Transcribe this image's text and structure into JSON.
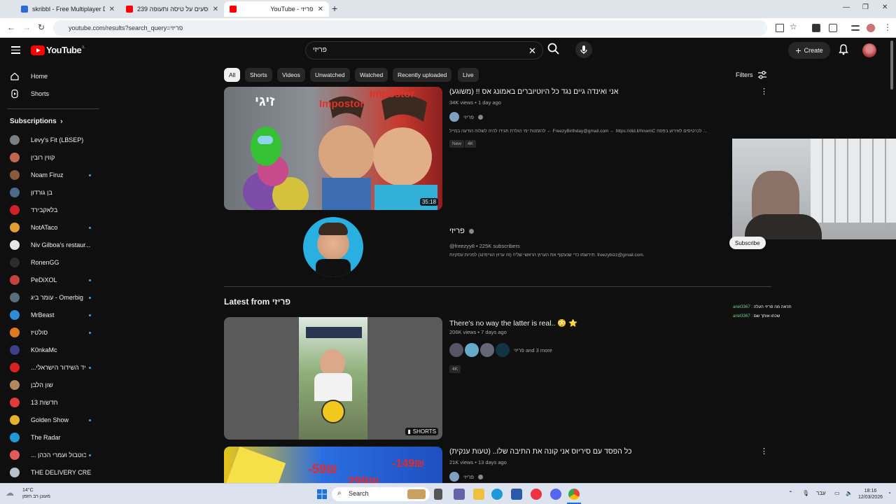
{
  "browser": {
    "tabs": [
      {
        "label": "skribbl - Free Multiplayer Draw",
        "color": "#2b6cd4"
      },
      {
        "label": "239 נוסעים על טיסה ותעופה | Tw",
        "color": "#ff0000"
      },
      {
        "label": "YouTube - פריזי",
        "color": "#ff0000"
      }
    ],
    "url": "youtube.com/results?search_query=פריזי"
  },
  "youtube": {
    "logo_text": "YouTube",
    "logo_country": "IL",
    "search_value": "פריזי",
    "create_label": "Create",
    "sidebar": {
      "home": "Home",
      "shorts": "Shorts",
      "subscriptions": "Subscriptions",
      "subs": [
        {
          "name": "Levy's Fit (LBSEP)",
          "color": "#7a7f86",
          "dot": false
        },
        {
          "name": "קווין רובין",
          "color": "#c0684f",
          "dot": false
        },
        {
          "name": "Noam Firuz",
          "color": "#8b5a3c",
          "dot": true
        },
        {
          "name": "בן גורדון",
          "color": "#4b6b8a",
          "dot": false
        },
        {
          "name": "בלאקבירד",
          "color": "#d0202a",
          "dot": false
        },
        {
          "name": "NotATaco",
          "color": "#e0a030",
          "dot": true
        },
        {
          "name": "Niv Gilboa's restaur...",
          "color": "#e6e6e6",
          "dot": false
        },
        {
          "name": "RonenGG",
          "color": "#2c2c2c",
          "dot": false
        },
        {
          "name": "PeDiXOL",
          "color": "#c6423c",
          "dot": true
        },
        {
          "name": "עומר ביג - Omerbig",
          "color": "#5a6e7a",
          "dot": true
        },
        {
          "name": "MrBeast",
          "color": "#2d8cd6",
          "dot": true
        },
        {
          "name": "סולטיז",
          "color": "#e07a1f",
          "dot": true
        },
        {
          "name": "K0nkaMc",
          "color": "#3d3f8a",
          "dot": false
        },
        {
          "name": "...יד השידור הישראלי",
          "color": "#d92121",
          "dot": true
        },
        {
          "name": "שון הלבן",
          "color": "#b08a5c",
          "dot": false
        },
        {
          "name": "חדשות 13",
          "color": "#e23b3b",
          "dot": false
        },
        {
          "name": "Golden Show",
          "color": "#e6b12c",
          "dot": true
        },
        {
          "name": "The Radar",
          "color": "#1f9ad6",
          "dot": false
        },
        {
          "name": "... בוטבול ועמרי הכהן",
          "color": "#e25b5b",
          "dot": true
        },
        {
          "name": "THE DELIVERY CRE...",
          "color": "#b9c2cc",
          "dot": false
        }
      ]
    },
    "chips": [
      "All",
      "Shorts",
      "Videos",
      "Unwatched",
      "Watched",
      "Recently uploaded",
      "Live"
    ],
    "filters_label": "Filters",
    "results": [
      {
        "title": "אני ואינדה גיים נגד כל היוטיוברים באמונג אס !! (משוגע)",
        "meta": "34K views • 1 day ago",
        "channel": "פריזי",
        "description": "להזמנות ימי הולדת תגידו להיה לשלוח הודעה במייל ← FreezyBirthday@gmail.com ← https://did.li/hnwmC לכרטיסים לאירוע בפסח ...",
        "badges": [
          "New",
          "4K"
        ],
        "duration": "35:18",
        "thumb_text_1": "זיגי",
        "thumb_text_2": "Impostor"
      }
    ],
    "channel": {
      "name": "פריזי",
      "handle_subs": "@freezyy8 • 225K subscribers",
      "description": "תירשמו כדי שנעקוף את הערוץ הראשי שלי!! (זה ערוץ הגיימינג) לפניות עסקיות: freezybizz@gmail.com."
    },
    "latest_heading": "Latest from פריזי",
    "latest": [
      {
        "title": "There's no way the latter is real.. 😳 ⭐",
        "meta": "206K views • 7 days ago",
        "channels": "פריזי and 3 more",
        "badges": [
          "4K"
        ],
        "shorts_label": "SHORTS"
      },
      {
        "title": "כל הפסד עם סיריוס אני קונה את התיבה שלו.. (טעות ענקית)",
        "meta": "21K views • 13 days ago",
        "channel": "פריזי",
        "price_1": "-59₪",
        "price_2": "-149₪",
        "price_3": "299₪"
      }
    ],
    "overlay": {
      "subscribe": "Subscribe",
      "chat": [
        {
          "user": "ariel3367 :",
          "msg": "תראה מה פריזי העלה"
        },
        {
          "user": "ariel3367 :",
          "msg": "שכחו אותך שם"
        }
      ]
    }
  },
  "taskbar": {
    "temp": "14°C",
    "weather": "מעונן רב הזמן",
    "search": "Search",
    "lang": "עבר",
    "time": "18:16",
    "date": "12/03/2026"
  }
}
